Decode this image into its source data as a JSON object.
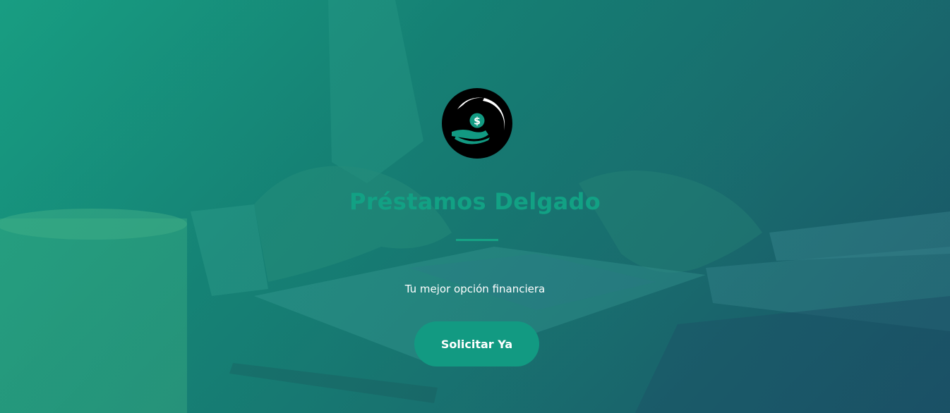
{
  "brand": {
    "name": "Préstamos Delgado",
    "logo_icon": "dollar-hand-icon",
    "logo_symbol": "$"
  },
  "hero": {
    "tagline": "Tu mejor opción financiera",
    "cta_label": "Solicitar Ya"
  },
  "colors": {
    "accent": "#12a184",
    "button": "#129a82",
    "text_light": "#ffffff",
    "overlay": "#167f74"
  }
}
